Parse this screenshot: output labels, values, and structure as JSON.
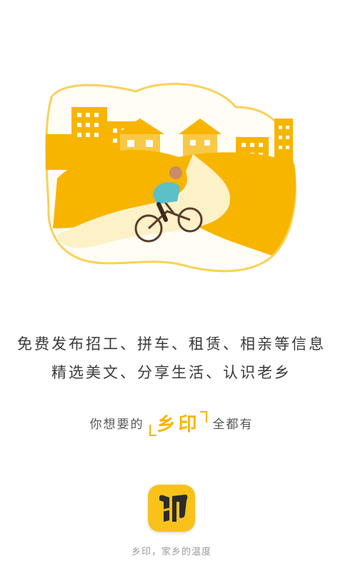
{
  "intro": {
    "line1": "免费发布招工、拼车、租赁、相亲等信息",
    "line2": "精选美文、分享生活、认识老乡"
  },
  "slogan": {
    "prefix": "你想要的",
    "brand": "乡印",
    "suffix": "全都有"
  },
  "app_icon": {
    "icon": "yin-logo-icon",
    "logo_text": "印"
  },
  "footer": {
    "tagline": "乡印，家乡的温度"
  },
  "colors": {
    "accent": "#f7b500",
    "icon_bg": "#f8c21b",
    "cream": "#fdf1c8",
    "text": "#3a3a3a",
    "muted": "#9a9a9a"
  }
}
